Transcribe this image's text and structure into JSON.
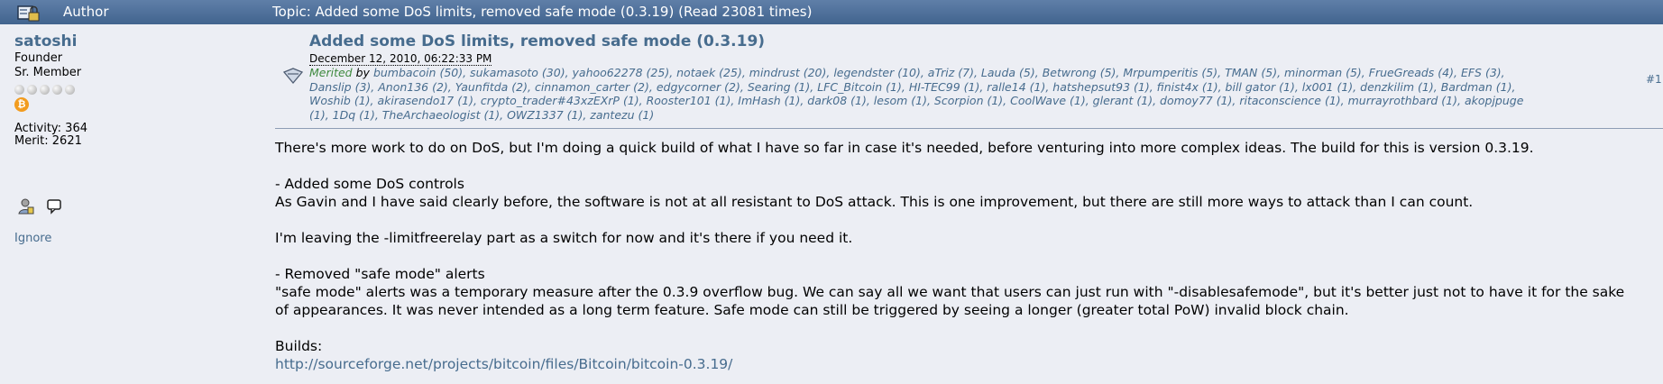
{
  "header": {
    "author_label": "Author",
    "topic_label": "Topic: Added some DoS limits, removed safe mode (0.3.19)  (Read 23081 times)"
  },
  "poster": {
    "name": "satoshi",
    "title": "Founder",
    "rank": "Sr. Member",
    "activity": "Activity: 364",
    "merit": "Merit: 2621",
    "ignore": "Ignore"
  },
  "post": {
    "title": "Added some DoS limits, removed safe mode (0.3.19)",
    "date": "December 12, 2010, 06:22:33 PM",
    "merited": "Merited",
    "by": "by",
    "merit_list_line1": "bumbacoin (50), sukamasoto (30), yahoo62278 (25), notaek (25), mindrust (20), legendster (10), aTriz (7), Lauda (5), Betwrong (5), Mrpumperitis (5), TMAN (5), minorman (5), FrueGreads (4), EFS (3),",
    "merit_list_line2": "Danslip (3), Anon136 (2), Yaunfitda (2), cinnamon_carter (2), edgycorner (2), Searing (1), LFC_Bitcoin (1), HI-TEC99 (1), ralle14 (1), hatshepsut93 (1), finist4x (1), bill gator (1), lx001 (1), denzkilim (1), Bardman (1),",
    "merit_list_line3": "Woshib (1), akirasendo17 (1), crypto_trader#43xzEXrP (1), Rooster101 (1), ImHash (1), dark08 (1), lesom (1), Scorpion (1), CoolWave (1), glerant (1), domoy77 (1), ritaconscience (1), murrayrothbard (1), akopjpuge",
    "merit_list_line4": "(1), 1Dq (1), TheArchaeologist (1), OWZ1337 (1), zantezu (1)",
    "post_number": "#1",
    "body": {
      "p1": "There's more work to do on DoS, but I'm doing a quick build of what I have so far in case it's needed, before venturing into more complex ideas.  The build for this is version 0.3.19.",
      "p2a": "- Added some DoS controls",
      "p2b": "As Gavin and I have said clearly before, the software is not at all resistant to DoS attack.  This is one improvement, but there are still more ways to attack than I can count.",
      "p3": "I'm leaving the -limitfreerelay part as a switch for now and it's there if you need it.",
      "p4a": "- Removed \"safe mode\" alerts",
      "p4b": "\"safe mode\" alerts was a temporary measure after the 0.3.9 overflow bug.  We can say all we want that users can just run with \"-disablesafemode\", but it's better just not to have it for the sake",
      "p4c": "of appearances.  It was never intended as a long term feature.  Safe mode can still be triggered by seeing a longer (greater total PoW) invalid block chain.",
      "p5a": "Builds:",
      "p5b": "http://sourceforge.net/projects/bitcoin/files/Bitcoin/bitcoin-0.3.19/"
    }
  },
  "icons": {
    "header": "lock-icon",
    "post": "topic-post-icon",
    "profile": "profile-icon",
    "message": "speech-bubble-icon",
    "coin": "bitcoin-icon"
  }
}
